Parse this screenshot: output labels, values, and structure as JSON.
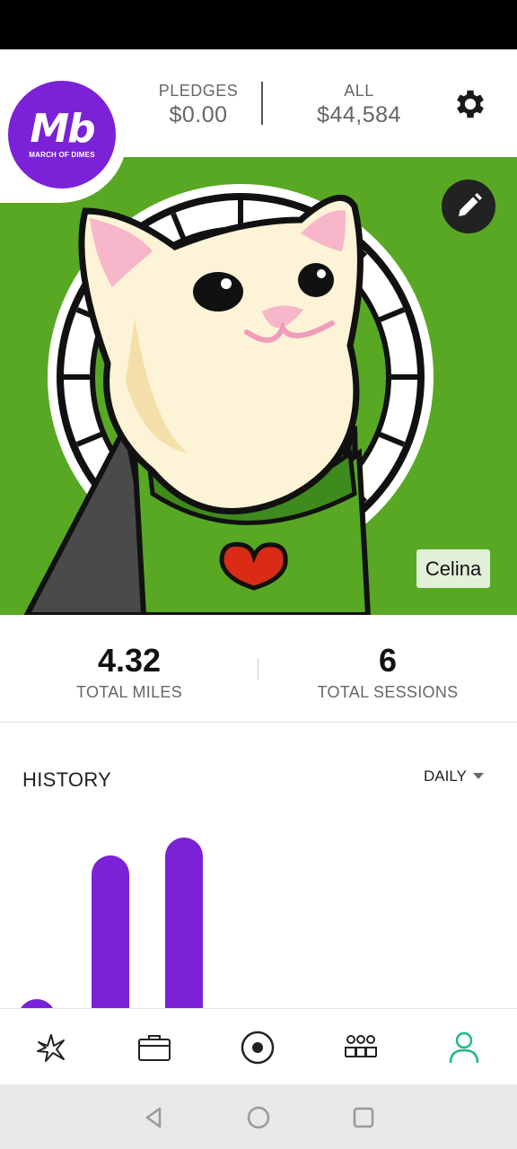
{
  "header": {
    "pledges_label": "PLEDGES",
    "pledges_value": "$0.00",
    "all_label": "ALL",
    "all_value": "$44,584"
  },
  "logo": {
    "mark": "Mb",
    "text": "MARCH OF DIMES"
  },
  "profile": {
    "name": "Celina"
  },
  "totals": {
    "miles_value": "4.32",
    "miles_label": "TOTAL MILES",
    "sessions_value": "6",
    "sessions_label": "TOTAL SESSIONS"
  },
  "history": {
    "title": "HISTORY",
    "period": "DAILY"
  },
  "colors": {
    "brand_purple": "#7b22d8",
    "photo_green": "#58a824",
    "active_nav": "#1fb88a"
  },
  "chart_data": {
    "type": "bar",
    "categories": [
      "",
      "",
      ""
    ],
    "values": [
      0.2,
      1.0,
      1.1
    ],
    "title": "",
    "xlabel": "",
    "ylabel": ""
  },
  "bottom_nav": [
    {
      "icon": "sparkle-icon",
      "active": false
    },
    {
      "icon": "briefcase-icon",
      "active": false
    },
    {
      "icon": "record-icon",
      "active": false
    },
    {
      "icon": "team-icon",
      "active": false
    },
    {
      "icon": "profile-icon",
      "active": true
    }
  ],
  "system_nav": [
    "back-icon",
    "home-icon",
    "recents-icon"
  ]
}
